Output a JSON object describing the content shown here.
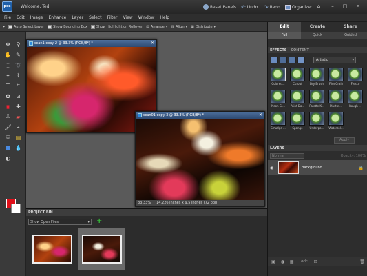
{
  "titlebar": {
    "app_logo": "pse",
    "welcome": "Welcome, Ted",
    "reset_panels": "Reset Panels",
    "undo": "Undo",
    "redo": "Redo",
    "organizer": "Organizer"
  },
  "menu": [
    "File",
    "Edit",
    "Image",
    "Enhance",
    "Layer",
    "Select",
    "Filter",
    "View",
    "Window",
    "Help"
  ],
  "options_bar": {
    "auto_select_layer": "Auto Select Layer",
    "show_bounding_box": "Show Bounding Box",
    "show_highlight": "Show Highlight on Rollover",
    "arrange": "Arrange",
    "align": "Align",
    "distribute": "Distribute"
  },
  "colors": {
    "foreground": "#e0101a",
    "background": "#ffffff",
    "accent_green": "#37c43a"
  },
  "doc1": {
    "title": "scan1 copy 2 @ 33.3% (RGB/8*) *"
  },
  "doc2": {
    "title": "scan01 copy 3 @ 33.3% (RGB/8*) *",
    "zoom": "33.33%",
    "size": "14.226 inches x 9.5 inches (72 ppi)"
  },
  "project_bin": {
    "header": "PROJECT BIN",
    "show": "Show Open Files",
    "add": "+"
  },
  "right_panel": {
    "tabs": [
      "Edit",
      "Create",
      "Share"
    ],
    "subtabs": [
      "Full",
      "Quick",
      "Guided"
    ],
    "effects_tab": "EFFECTS",
    "content_tab": "CONTENT",
    "filter_select": "Artistic",
    "effects": [
      "Colored...",
      "Cutout",
      "Dry Brush",
      "Film Grain",
      "Fresco",
      "Neon Gl...",
      "Paint Da...",
      "Palette K...",
      "Plastic ...",
      "Rough ...",
      "Smudge ...",
      "Sponge",
      "Underpa...",
      "Watercol..."
    ],
    "apply": "Apply",
    "layers_header": "LAYERS",
    "blend_mode": "Normal",
    "opacity": "Opacity: 100%",
    "layer_name": "Background",
    "lock": "Lock:"
  }
}
